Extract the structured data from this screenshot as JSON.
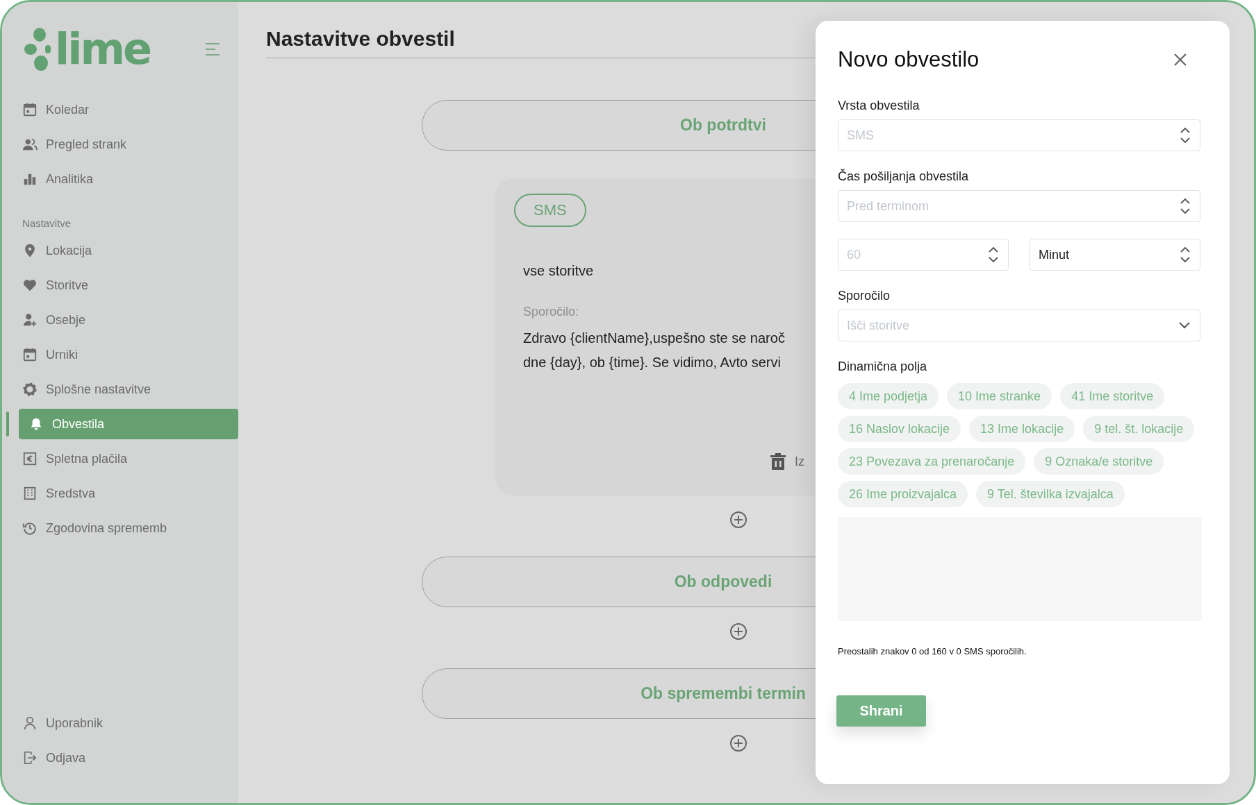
{
  "sidebar": {
    "logo_text": "lime",
    "main_items": [
      {
        "label": "Koledar",
        "selected": false
      },
      {
        "label": "Pregled strank",
        "selected": false
      },
      {
        "label": "Analitika",
        "selected": false
      }
    ],
    "settings_heading": "Nastavitve",
    "settings_items": [
      {
        "label": "Lokacija",
        "selected": false
      },
      {
        "label": "Storitve",
        "selected": false
      },
      {
        "label": "Osebje",
        "selected": false
      },
      {
        "label": "Urniki",
        "selected": false
      },
      {
        "label": "Splošne nastavitve",
        "selected": false
      },
      {
        "label": "Obvestila",
        "selected": true
      },
      {
        "label": "Spletna plačila",
        "selected": false
      },
      {
        "label": "Sredstva",
        "selected": false
      },
      {
        "label": "Zgodovina sprememb",
        "selected": false
      }
    ],
    "bottom_items": [
      {
        "label": "Uporabnik",
        "selected": false
      },
      {
        "label": "Odjava",
        "selected": false
      }
    ]
  },
  "page_title": "Nastavitve obvestil",
  "sections": [
    {
      "title": "Ob potrdtvi",
      "notifications": [
        {
          "badge": "SMS",
          "services": "vse storitve",
          "message_label": "Sporočilo:",
          "message_lines": [
            "Zdravo {clientName},uspešno ste se naroč",
            "dne {day}, ob {time}. Se vidimo, Avto servi"
          ],
          "delete_label": "Iz"
        }
      ]
    },
    {
      "title": "Ob odpovedi"
    },
    {
      "title": "Ob spremembi termin"
    }
  ],
  "modal": {
    "title": "Novo obvestilo",
    "type_field": {
      "label": "Vrsta obvestila",
      "placeholder": "SMS"
    },
    "time_field": {
      "label": "Čas pošiljanja obvestila",
      "placeholder": "Pred terminom"
    },
    "amount_field": {
      "placeholder": "60"
    },
    "unit_field": {
      "value": "Minut"
    },
    "message_field": {
      "label": "Sporočilo",
      "placeholder": "Išči storitve"
    },
    "dynamic_label": "Dinamična polja",
    "dynamic_fields": [
      "4 Ime podjetja",
      "10 Ime stranke",
      "41 Ime storitve",
      "16 Naslov lokacije",
      "13 Ime lokacije",
      "9 tel. št. lokacije",
      "23 Povezava za prenaročanje",
      "9 Oznaka/e storitve",
      "26 Ime proizvajalca",
      "9 Tel. številka izvajalca"
    ],
    "counter": "Preostalih znakov 0 od 160 v 0 SMS sporočilih.",
    "save_button": "Shrani"
  }
}
